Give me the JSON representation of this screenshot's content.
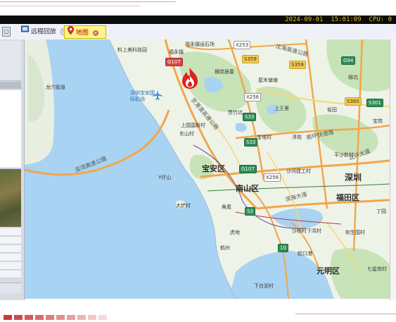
{
  "statusbar": {
    "datetime": "2024-09-01  15:01:09",
    "cpu": "CPU: 0"
  },
  "tabs": [
    {
      "label": "远程回放"
    },
    {
      "label": "地图"
    }
  ],
  "map": {
    "labels": {
      "district_baoan": "宝安区",
      "district_nanshan": "南山区",
      "district_futian": "福田区",
      "district_yuanming": "元明区",
      "city_shenzhen": "深圳",
      "airport": "深圳宝安国际机场",
      "expressway_1": "深湾高速公路",
      "expressway_2": "京港澳高速公路",
      "expressway_3": "沈海高速公路",
      "expressway_4": "南坪快速路",
      "expressway_5": "北环大道",
      "expressway_6": "滨海大道",
      "road_shengzhou": "沙河建工村",
      "road_shekou": "沙桥村下湾村",
      "village_1": "料上美科技园",
      "village_2": "福永镇",
      "village_3": "龙穴街道",
      "village_4": "上围国新村",
      "village_5": "东山村",
      "village_6": "宝塔村",
      "village_7": "贾竹坑",
      "village_8": "上王里",
      "village_9": "大铲村",
      "village_10": "Y仔山",
      "village_11": "角尾",
      "village_12": "虎地",
      "village_13": "棉坑",
      "village_14": "七星岗村",
      "village_15": "下白泥村",
      "village_16": "和生围村",
      "village_17": "丁园",
      "village_18": "坂田",
      "village_19": "浮岗",
      "village_20": "宝岗",
      "village_21": "鹤州",
      "village_22": "福永镇运石场",
      "village_23": "屋禾塘塘",
      "village_24": "横岗居委",
      "village_25": "蛇口港",
      "village_26": "平沙新村"
    },
    "shields": {
      "g107_a": "G107",
      "g107_b": "G107",
      "x253": "X253",
      "s359_a": "S359",
      "s359_b": "S359",
      "g94": "G94",
      "x256_a": "X256",
      "x256_b": "X256",
      "s33_a": "S33",
      "s33_b": "S33",
      "s33_c": "S3",
      "s360": "S360",
      "s301": "S301",
      "r10": "10"
    }
  },
  "colors": {
    "sea": "#a9d3f2",
    "land": "#eef3e8",
    "green": "#c7e3b7",
    "road_orange": "#f2a649",
    "road_yellow": "#f7d778",
    "accent_map_tab": "#fff58a"
  },
  "icons": {
    "fire": "fire-icon",
    "airport": "airplane-icon",
    "remote_playback": "playback-icon",
    "map_tab": "map-pin-icon"
  }
}
